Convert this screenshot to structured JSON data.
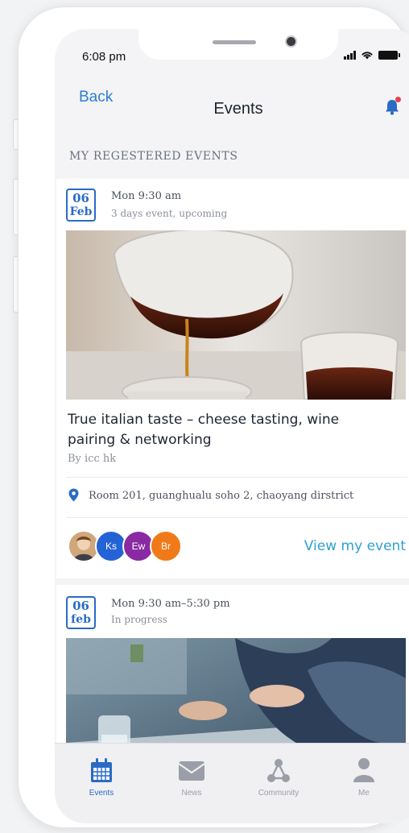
{
  "status_bar": {
    "time": "6:08 pm"
  },
  "nav": {
    "back_label": "Back",
    "title": "Events"
  },
  "section": {
    "label": "MY REGESTERED EVENTS"
  },
  "events": [
    {
      "date_day": "06",
      "date_month": "Feb",
      "time": "Mon 9:30 am",
      "status": "3 days event, upcoming",
      "title": "True italian taste – cheese tasting, wine pairing & networking",
      "by": "By icc hk",
      "location": "Room 201, guanghualu soho 2, chaoyang dirstrict",
      "attendees": [
        "Ks",
        "Ew",
        "Br"
      ],
      "action_label": "View my event"
    },
    {
      "date_day": "06",
      "date_month": "feb",
      "time": "Mon 9:30 am–5:30 pm",
      "status": "In progress"
    }
  ],
  "tabbar": [
    {
      "label": "Events",
      "icon": "calendar-icon",
      "active": true
    },
    {
      "label": "News",
      "icon": "envelope-icon",
      "active": false
    },
    {
      "label": "Community",
      "icon": "network-icon",
      "active": false
    },
    {
      "label": "Me",
      "icon": "person-icon",
      "active": false
    }
  ],
  "colors": {
    "accent": "#2a6bc6",
    "link": "#2fa0d2",
    "back": "#2a7fd6",
    "notification_dot": "#e8414a"
  }
}
